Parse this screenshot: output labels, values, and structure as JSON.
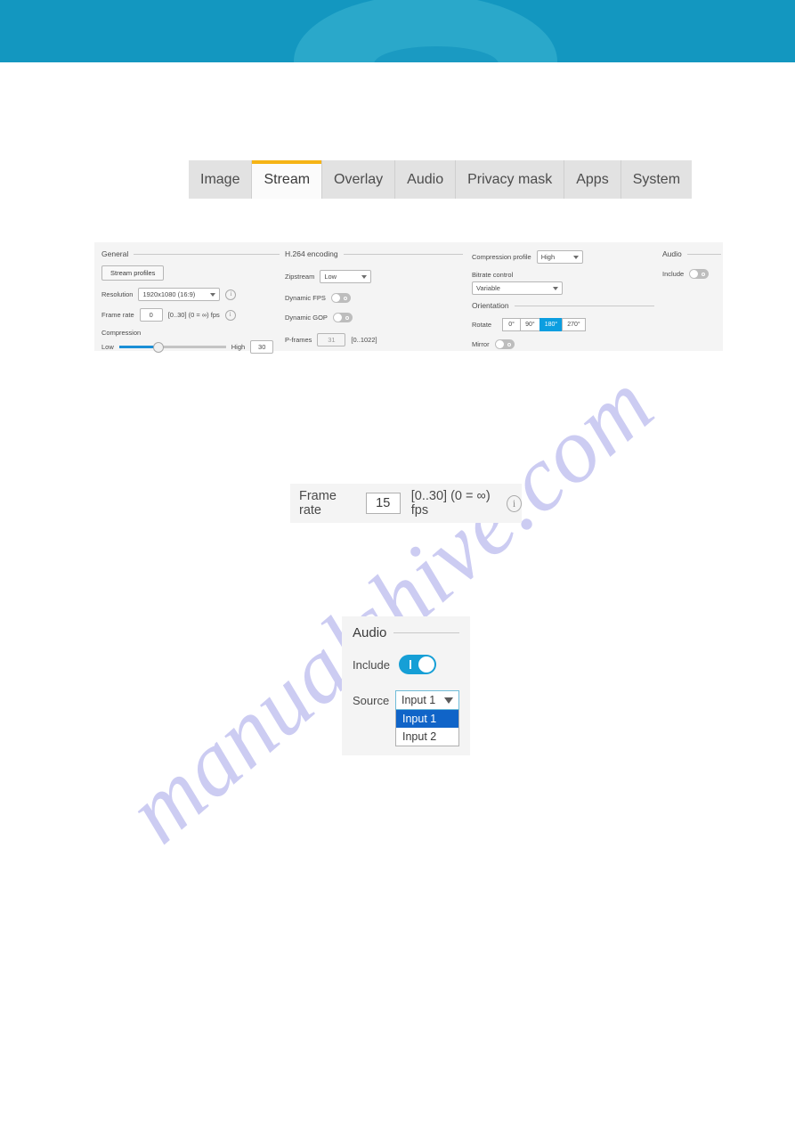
{
  "banner": {
    "color": "#1397c0",
    "arc_color": "#2aa8ca",
    "ellipse_color": "#1a9ac2"
  },
  "watermark": {
    "text": "manualshive.com",
    "color": "#ccccf2"
  },
  "tabs": {
    "items": [
      {
        "label": "Image",
        "active": false
      },
      {
        "label": "Stream",
        "active": true
      },
      {
        "label": "Overlay",
        "active": false
      },
      {
        "label": "Audio",
        "active": false
      },
      {
        "label": "Privacy mask",
        "active": false
      },
      {
        "label": "Apps",
        "active": false
      },
      {
        "label": "System",
        "active": false
      }
    ],
    "active_indicator_color": "#f5b416"
  },
  "panel": {
    "general": {
      "heading": "General",
      "stream_profiles_button": "Stream profiles",
      "resolution_label": "Resolution",
      "resolution_value": "1920x1080 (16:9)",
      "frame_rate_label": "Frame rate",
      "frame_rate_value": "0",
      "frame_rate_hint": "[0..30] (0 = ∞) fps",
      "compression_label": "Compression",
      "compression_low": "Low",
      "compression_high": "High",
      "compression_value": "30",
      "compression_percent": 36
    },
    "h264": {
      "heading": "H.264 encoding",
      "zipstream_label": "Zipstream",
      "zipstream_value": "Low",
      "dynamic_fps_label": "Dynamic FPS",
      "dynamic_fps_on": false,
      "dynamic_gop_label": "Dynamic GOP",
      "dynamic_gop_on": false,
      "p_frames_label": "P-frames",
      "p_frames_value": "31",
      "p_frames_hint": "[0..1022]"
    },
    "profile": {
      "compression_profile_label": "Compression profile",
      "compression_profile_value": "High",
      "bitrate_control_label": "Bitrate control",
      "bitrate_control_value": "Variable",
      "orientation_heading": "Orientation",
      "rotate_label": "Rotate",
      "rotate_options": [
        "0°",
        "90°",
        "180°",
        "270°"
      ],
      "rotate_selected": "180°",
      "mirror_label": "Mirror",
      "mirror_on": false
    },
    "audio": {
      "heading": "Audio",
      "include_label": "Include",
      "include_on": false
    },
    "info_icon": "i"
  },
  "frame_rate_callout": {
    "label": "Frame rate",
    "value": "15",
    "hint": "[0..30] (0 = ∞) fps",
    "info_icon": "i"
  },
  "audio_callout": {
    "heading": "Audio",
    "include_label": "Include",
    "include_on": true,
    "source_label": "Source",
    "source_value": "Input 1",
    "options": [
      {
        "label": "Input 1",
        "selected": true
      },
      {
        "label": "Input 2",
        "selected": false
      }
    ],
    "highlight_color": "#1064c8",
    "toggle_on_color": "#169fd6"
  }
}
